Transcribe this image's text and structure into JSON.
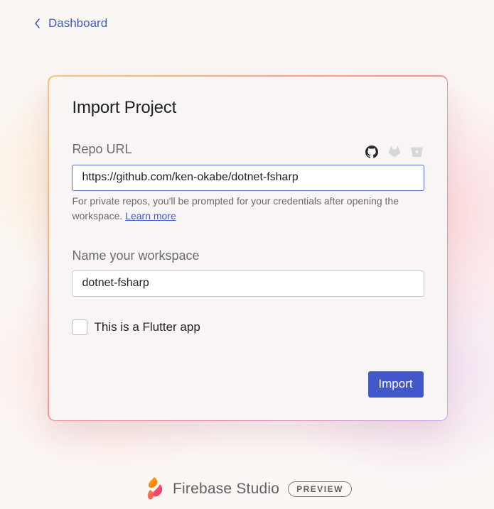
{
  "nav": {
    "back_label": "Dashboard"
  },
  "card": {
    "title": "Import Project",
    "repo": {
      "label": "Repo URL",
      "value": "https://github.com/ken-okabe/dotnet-fsharp",
      "providers": [
        "github-icon",
        "gitlab-icon",
        "bitbucket-icon"
      ],
      "helper_text": "For private repos, you'll be prompted for your credentials after opening the workspace.",
      "learn_more": "Learn more"
    },
    "workspace": {
      "label": "Name your workspace",
      "value": "dotnet-fsharp"
    },
    "flutter": {
      "label": "This is a Flutter app",
      "checked": false
    },
    "import_label": "Import"
  },
  "footer": {
    "brand_name": "Firebase Studio",
    "badge": "PREVIEW"
  },
  "colors": {
    "accent": "#4257c9",
    "link": "#3f5bc4"
  }
}
